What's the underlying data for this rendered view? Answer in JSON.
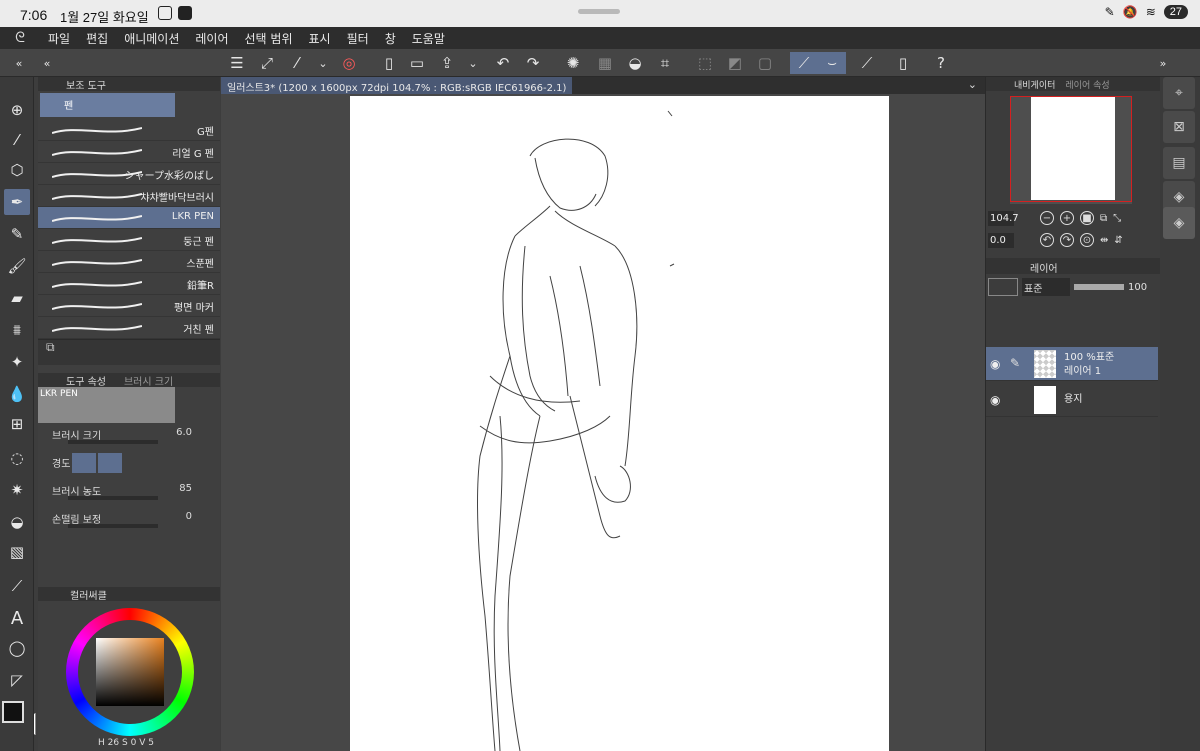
{
  "status_bar": {
    "time": "7:06",
    "date": "1월 27일 화요일",
    "battery": "27"
  },
  "menu": {
    "items": [
      "파일",
      "편집",
      "애니메이션",
      "레이어",
      "선택 범위",
      "표시",
      "필터",
      "창",
      "도움말"
    ]
  },
  "subtool_panel": {
    "tab_label": "보조 도구",
    "group_label": "펜",
    "items": [
      {
        "label": "G펜"
      },
      {
        "label": "리얼 G 펜"
      },
      {
        "label": "シャープ水彩のばし"
      },
      {
        "label": "챠챠빨바닥브러시"
      },
      {
        "label": "LKR PEN"
      },
      {
        "label": "둥근 펜"
      },
      {
        "label": "스푼펜"
      },
      {
        "label": "鉛筆R"
      },
      {
        "label": "평면 마커"
      },
      {
        "label": "거친 펜"
      }
    ],
    "selected_index": 4
  },
  "tool_property": {
    "tab_label": "도구 속성",
    "tab2_label": "브러시 크기",
    "tool_name": "LKR PEN",
    "brush_size_label": "브러시 크기",
    "brush_size_value": "6.0",
    "hardness_label": "경도",
    "density_label": "브러시 농도",
    "density_value": "85",
    "stabilization_label": "손떨림 보정",
    "stabilization_value": "0"
  },
  "color_panel": {
    "tab_label": "컬러써클",
    "h_label": "H",
    "h_value": "26",
    "s_label": "S",
    "s_value": "0",
    "v_label": "V",
    "v_value": "5"
  },
  "document": {
    "tab_title": "일러스트3* (1200 x 1600px 72dpi 104.7% : RGB:sRGB IEC61966-2.1)"
  },
  "navigator": {
    "tab_label": "내비게이터",
    "tab2_label": "레이어 속성",
    "zoom": "104.7",
    "rotation": "0.0"
  },
  "layer_panel": {
    "tab_label": "레이어",
    "blend_mode": "표준",
    "opacity": "100",
    "layers": [
      {
        "info": "100 %표준",
        "name": "레이어 1"
      },
      {
        "info": "",
        "name": "용지"
      }
    ]
  },
  "colors": {
    "accent": "#5d6f90",
    "panel_bg": "#3f3f3f",
    "canvas_bg": "#ffffff"
  }
}
